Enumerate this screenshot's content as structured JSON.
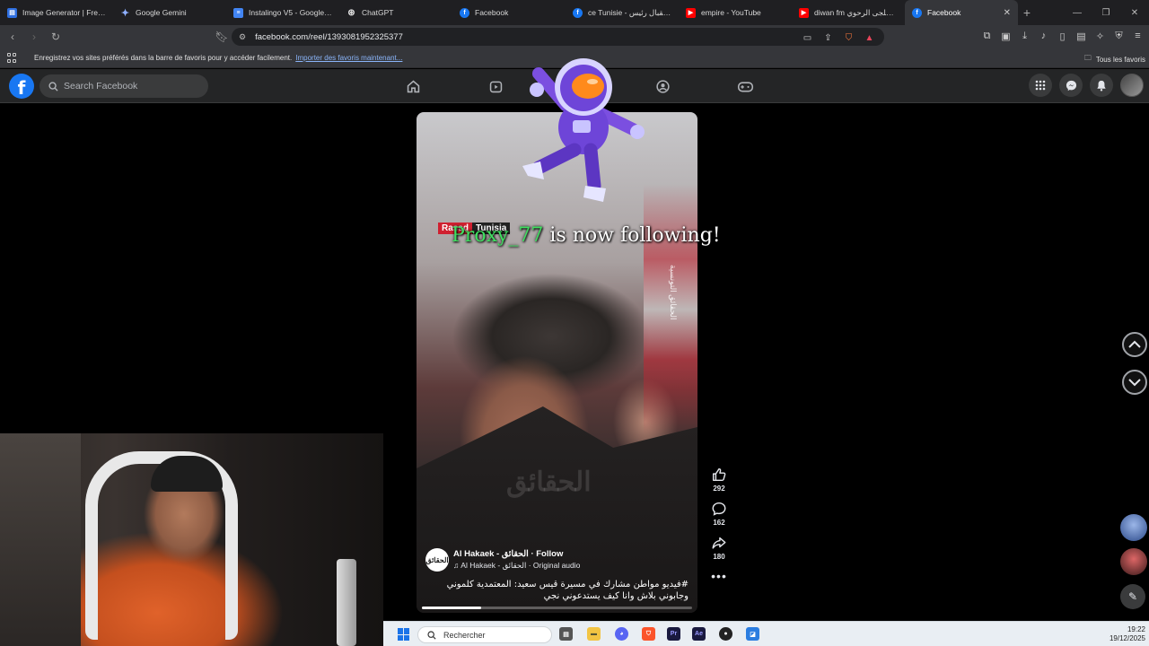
{
  "browser": {
    "tabs": [
      {
        "label": "Image Generator | Freepik",
        "icon": "freepik-icon",
        "color": "#2f6fe0"
      },
      {
        "label": "Google Gemini",
        "icon": "gemini-icon",
        "color": "#6d8df5"
      },
      {
        "label": "Instalingo V5 - Google Do",
        "icon": "google-docs-icon",
        "color": "#4285f4"
      },
      {
        "label": "ChatGPT",
        "icon": "chatgpt-icon",
        "color": "#777777"
      },
      {
        "label": "Facebook",
        "icon": "facebook-icon",
        "color": "#1877f2"
      },
      {
        "label": "ce Tunisie - استقبال رئيس...",
        "icon": "facebook-icon",
        "color": "#1877f2"
      },
      {
        "label": "empire - YouTube",
        "icon": "youtube-icon",
        "color": "#ff0000"
      },
      {
        "label": "diwan fm ملجى الرحوي - Y",
        "icon": "youtube-icon",
        "color": "#ff0000"
      }
    ],
    "active_tab": {
      "label": "Facebook",
      "icon": "facebook-icon",
      "color": "#1877f2"
    },
    "url": "facebook.com/reel/1393081952325377",
    "bookmark_prompt": "Enregistrez vos sites préférés dans la barre de favoris pour y accéder facilement.",
    "bookmark_link": "Importer des favoris maintenant...",
    "all_favorites": "Tous les favoris"
  },
  "facebook": {
    "search_placeholder": "Search Facebook",
    "accent": "#1877f2"
  },
  "reel": {
    "brand_red": "Rassd",
    "brand_dark": "Tunisia",
    "vertical_label": "الحقائق التونسية",
    "watermark": "الحقائق",
    "author_badge": "الحقائق",
    "author_name": "Al Hakaek - الحقائق · Follow",
    "audio": "Al Hakaek - الحقائق · Original audio",
    "caption": "#فيديو مواطن مشارك في مسيرة قيس سعيد: المعتمدية كلموني وجابوني بلاش وانا كيف يستدعوني نجي",
    "likes": "292",
    "comments": "162",
    "shares": "180",
    "progress": 0.22
  },
  "overlay": {
    "follower": "Proxy_77",
    "follow_text": "is now following!",
    "follower_color": "#3fe060"
  },
  "taskbar": {
    "search": "Rechercher",
    "time": "19:22",
    "date": "19/12/2025"
  }
}
